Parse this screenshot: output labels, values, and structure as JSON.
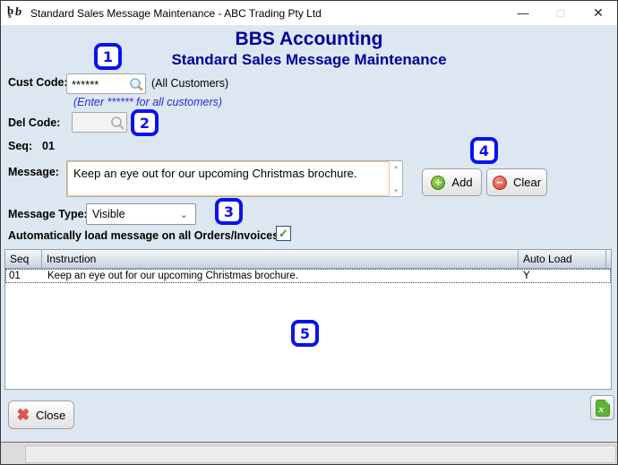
{
  "window": {
    "title": "Standard Sales Message Maintenance - ABC Trading Pty Ltd",
    "app_header": "BBS Accounting",
    "screen_header": "Standard Sales Message Maintenance"
  },
  "titlebar_icons": {
    "minimize": "—",
    "maximize": "▢",
    "close": "✕"
  },
  "form": {
    "cust_code": {
      "label": "Cust Code:",
      "value": "******",
      "suffix": "(All Customers)",
      "hint": "(Enter ****** for all customers)"
    },
    "del_code": {
      "label": "Del Code:",
      "value": ""
    },
    "seq": {
      "label": "Seq:",
      "value": "01"
    },
    "message": {
      "label": "Message:",
      "value": "Keep an eye out for our upcoming Christmas brochure."
    },
    "message_type": {
      "label": "Message Type:",
      "value": "Visible"
    },
    "auto_load": {
      "label": "Automatically load message on all Orders/Invoices:",
      "checked": true
    }
  },
  "buttons": {
    "add": "Add",
    "clear": "Clear",
    "close": "Close"
  },
  "icons": {
    "add_plus": "+",
    "clear_minus": "−",
    "close_x": "✖",
    "excel_x": "x",
    "check": "✓",
    "select_chevron": "⌄",
    "scroll_up": "▲",
    "scroll_down": "▼",
    "logo_b1": "b",
    "logo_s": "s",
    "logo_b2": "b"
  },
  "callouts": [
    "1",
    "2",
    "3",
    "4",
    "5"
  ],
  "table": {
    "columns": [
      "Seq",
      "Instruction",
      "Auto Load"
    ],
    "rows": [
      {
        "seq": "01",
        "instruction": "Keep an eye out for our upcoming Christmas brochure.",
        "auto_load": "Y"
      }
    ]
  },
  "colors": {
    "header_navy": "#000099",
    "callout_blue": "#0a12ee",
    "hint_blue": "#2a2ad2",
    "focus_orange": "#f2c18a",
    "add_green": "#57a829",
    "clear_red": "#d8402f",
    "close_red": "#e2574c",
    "excel_green": "#5fb336",
    "check_green": "#2f9e2f",
    "window_bg": "#dde7f1"
  }
}
